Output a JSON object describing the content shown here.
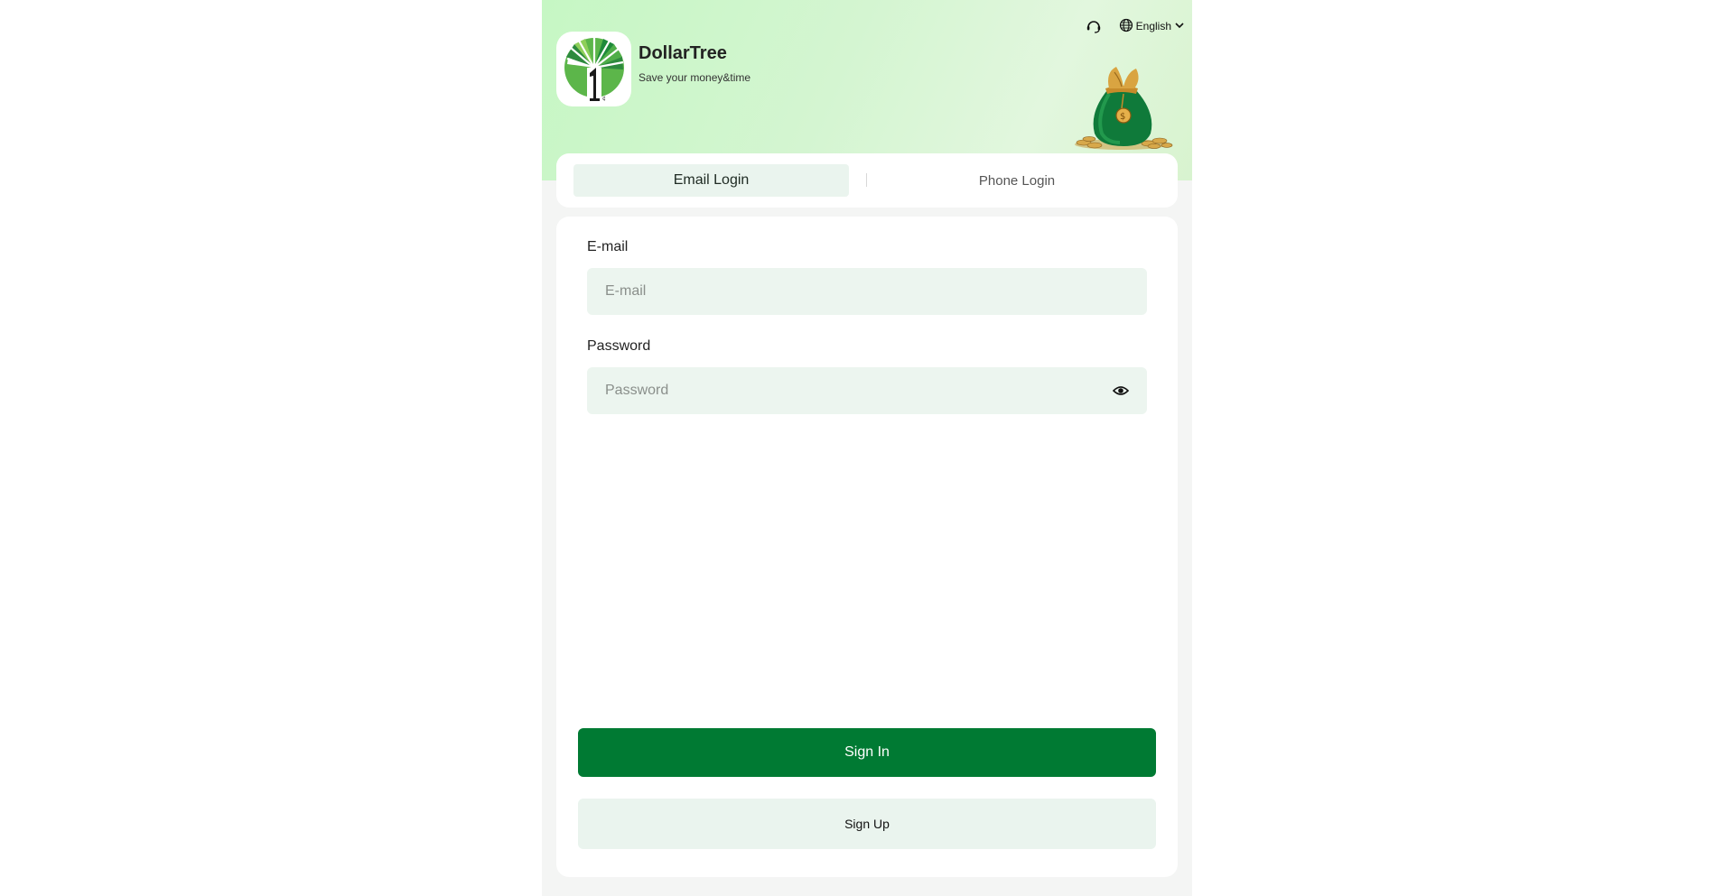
{
  "header": {
    "support_icon": "headset-icon",
    "language_icon": "globe-icon",
    "language_label": "English",
    "dropdown_icon": "chevron-down-icon"
  },
  "brand": {
    "name": "DollarTree",
    "tagline": "Save your money&time",
    "logo_icon": "dollartree-logo",
    "decoration": "money-bag-image"
  },
  "tabs": [
    {
      "label": "Email Login",
      "active": true
    },
    {
      "label": "Phone Login",
      "active": false
    }
  ],
  "form": {
    "email_label": "E-mail",
    "email_placeholder": "E-mail",
    "email_value": "",
    "password_label": "Password",
    "password_placeholder": "Password",
    "password_value": "",
    "eye_icon": "eye-icon"
  },
  "buttons": {
    "sign_in": "Sign In",
    "sign_up": "Sign Up"
  },
  "colors": {
    "primary": "#007a33",
    "field_bg": "#ecf5ef",
    "hero_bg": "#c6f7c4"
  }
}
